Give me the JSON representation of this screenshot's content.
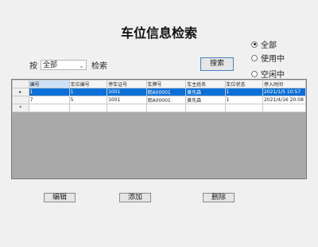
{
  "title": "车位信息检索",
  "filter": {
    "options": [
      "全部",
      "使用中",
      "空闲中"
    ],
    "selected_index": 0
  },
  "search": {
    "prefix_label": "按",
    "field_value": "全部",
    "suffix_label": "检索",
    "button_label": "搜索"
  },
  "table": {
    "columns": [
      "编号",
      "车位编号",
      "停车证号",
      "车牌号",
      "车主姓名",
      "车位状态",
      "停入时间"
    ],
    "rows": [
      [
        "1",
        "1",
        "1001",
        "皖A00001",
        "黄先森",
        "1",
        "2021/1/5 10:57"
      ],
      [
        "7",
        "5",
        "1001",
        "皖A00001",
        "黄先森",
        "1",
        "2021/4/16 20:08"
      ]
    ],
    "selected_row": 0,
    "current_row_marker": "▸",
    "new_row_marker": "*"
  },
  "actions": {
    "edit_label": "编辑",
    "add_label": "添加",
    "delete_label": "删除"
  }
}
